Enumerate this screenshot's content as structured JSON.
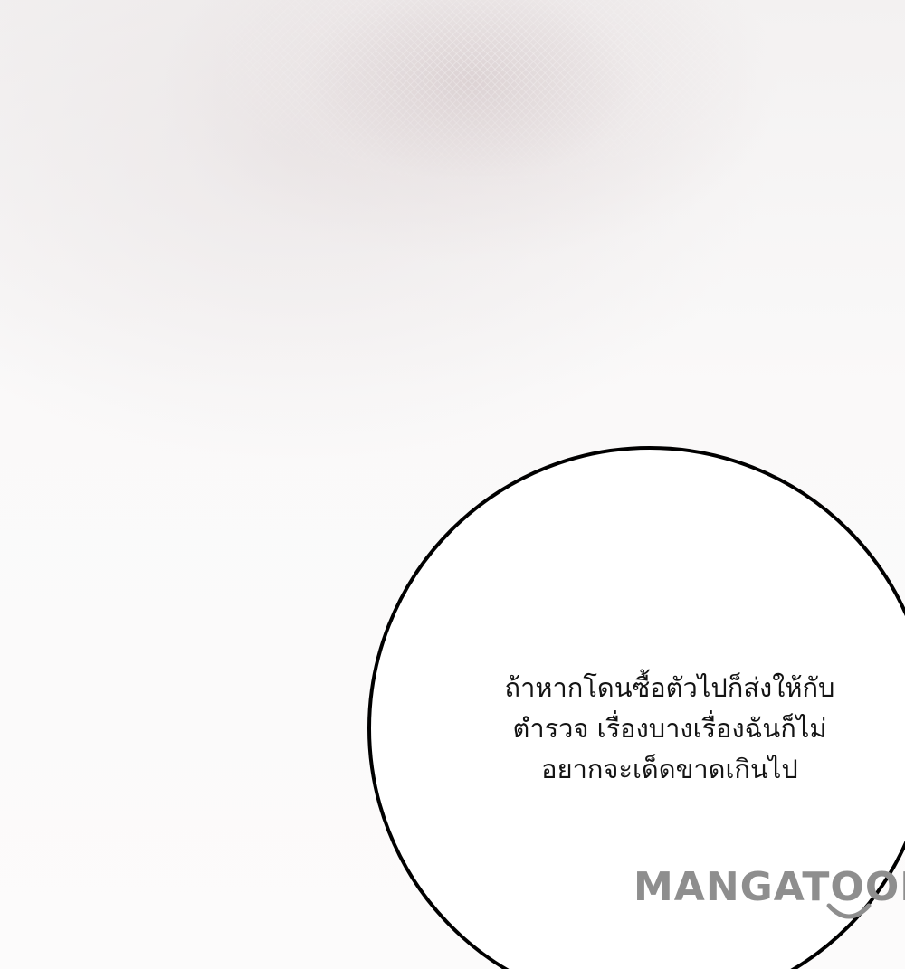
{
  "speech_bubble": {
    "lines": [
      "ถ้าหากโดนซื้อตัวไปก็ส่งให้กับ",
      "ตำรวจ เรื่องบางเรื่องฉันก็ไม่",
      "อยากจะเด็ดขาดเกินไป"
    ]
  },
  "watermark": {
    "text": "MANGATOON"
  },
  "colors": {
    "outline": "#000000",
    "text": "#141414",
    "watermark": "#8e8e8e",
    "background": "#fbfafa"
  }
}
